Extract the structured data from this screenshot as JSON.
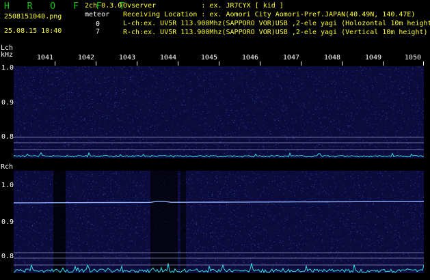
{
  "app": {
    "title": "H R O F F T",
    "version": "2ch 0.3.0",
    "filename": "2508151040.png",
    "datetime": "25.08.15 10:40"
  },
  "meteor": {
    "label": "meteor",
    "lch_count": "0",
    "rch_count": "7"
  },
  "info": {
    "observer": "Ovserver           : ex. JR7CYX [ kid ]",
    "location": "Receiving Location : ex. Aomori City Aomori-Pref.JAPAN(40.49N, 140.47E)",
    "lch": "L-ch:ex. UV5R 113.900Mhz(SAPPORO VOR)USB ,2-ele yagi (Holozontal 10m height)",
    "rch": "R-ch:ex. UV5R 113.900Mhz(SAPPORO VOR)USB ,2-ele yagi (Vertical 10m height)"
  },
  "lch_panel": {
    "label": "Lch",
    "unit": "kHz",
    "y_ticks": [
      "1.0",
      "0.9",
      "0.8"
    ]
  },
  "rch_panel": {
    "label": "Rch",
    "y_ticks": [
      "1.0",
      "0.9",
      "0.8"
    ]
  },
  "freq_axis": {
    "labels": [
      "1041",
      "1042",
      "1043",
      "1044",
      "1045",
      "1046",
      "1047",
      "1048",
      "1049",
      "1050"
    ]
  },
  "colors": {
    "background": "#000000",
    "panel": "#0b0b3e",
    "title": "#19c819",
    "text_yellow": "#ffff33",
    "level": "#33e0e8",
    "echo_line": "#8fb0ff"
  }
}
